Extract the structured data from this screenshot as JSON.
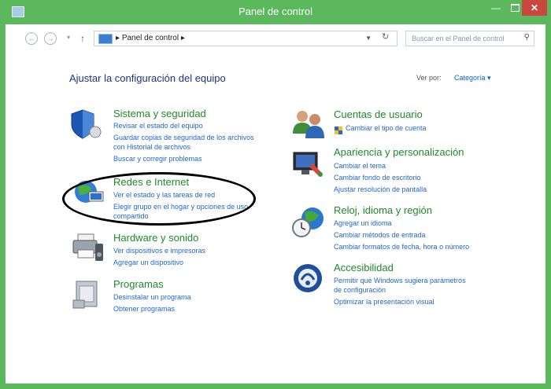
{
  "window": {
    "title": "Panel de control"
  },
  "address": {
    "path": "Panel de control",
    "separator": "▸"
  },
  "search": {
    "placeholder": "Buscar en el Panel de control"
  },
  "heading": "Ajustar la configuración del equipo",
  "view_by": {
    "label": "Ver por:",
    "value": "Categoría ▾"
  },
  "left_categories": [
    {
      "title": "Sistema y seguridad",
      "icon": "shield-icon",
      "links": [
        "Revisar el estado del equipo",
        "Guardar copias de seguridad de los archivos",
        "con Historial de archivos",
        "Buscar y corregir problemas"
      ]
    },
    {
      "title": "Redes e Internet",
      "icon": "network-globe-icon",
      "links": [
        "Ver el estado y las tareas de red",
        "Elegir grupo en el hogar y opciones de uso",
        "compartido"
      ]
    },
    {
      "title": "Hardware y sonido",
      "icon": "printer-speaker-icon",
      "links": [
        "Ver dispositivos e impresoras",
        "Agregar un dispositivo"
      ]
    },
    {
      "title": "Programas",
      "icon": "programs-icon",
      "links": [
        "Desinstalar un programa",
        "Obtener programas"
      ]
    }
  ],
  "right_categories": [
    {
      "title": "Cuentas de usuario",
      "icon": "users-icon",
      "links": [
        "Cambiar el tipo de cuenta"
      ]
    },
    {
      "title": "Apariencia y personalización",
      "icon": "monitor-paint-icon",
      "links": [
        "Cambiar el tema",
        "Cambiar fondo de escritorio",
        "Ajustar resolución de pantalla"
      ]
    },
    {
      "title": "Reloj, idioma y región",
      "icon": "clock-globe-icon",
      "links": [
        "Agregar un idioma",
        "Cambiar métodos de entrada",
        "Cambiar formatos de fecha, hora o número"
      ]
    },
    {
      "title": "Accesibilidad",
      "icon": "accessibility-icon",
      "links": [
        "Permitir que Windows sugiera parámetros",
        "de configuración",
        "Optimizar la presentación visual"
      ]
    }
  ],
  "colors": {
    "titlebar": "#5cb85c",
    "link": "#2466cc",
    "category": "#1f8a2a",
    "heading": "#1e3287",
    "close": "#c9473e"
  }
}
